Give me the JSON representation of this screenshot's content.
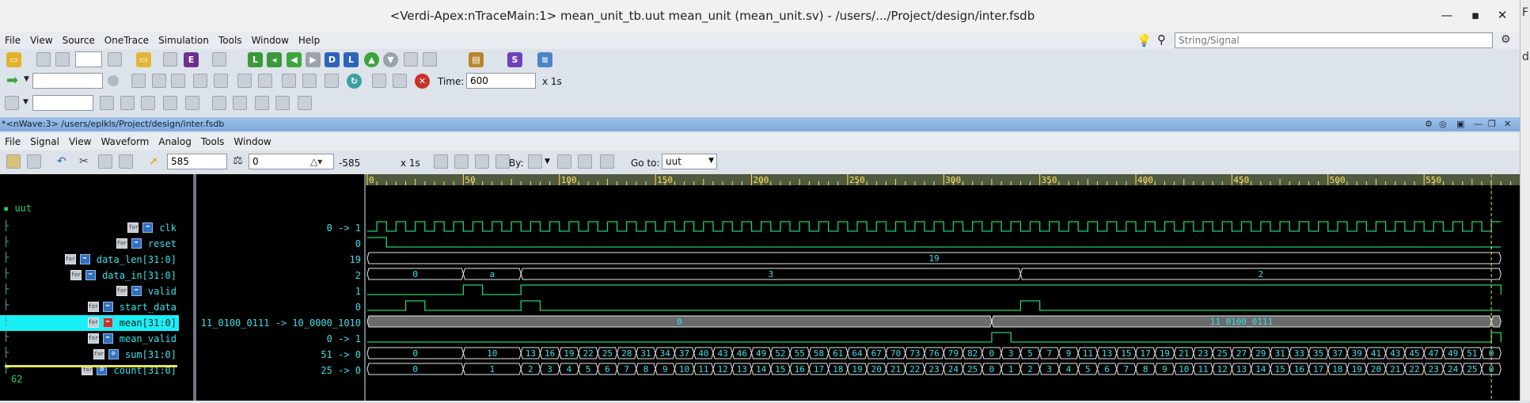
{
  "window": {
    "title": "<Verdi-Apex:nTraceMain:1> mean_unit_tb.uut mean_unit (mean_unit.sv) - /users/.../Project/design/inter.fsdb",
    "min_glyph": "—",
    "max_glyph": "▪",
    "close_glyph": "✕",
    "right_strip_chars": [
      "F",
      "d"
    ]
  },
  "main_menu": [
    "File",
    "View",
    "Source",
    "OneTrace",
    "Simulation",
    "Tools",
    "Window",
    "Help"
  ],
  "search": {
    "placeholder": "String/Signal"
  },
  "main_toolbar2": {
    "time_label": "Time:",
    "time_value": "600",
    "time_unit": "x 1s"
  },
  "nwave": {
    "title": "*<nWave:3> /users/eplkls/Project/design/inter.fsdb",
    "menu": [
      "File",
      "Signal",
      "View",
      "Waveform",
      "Analog",
      "Tools",
      "Window"
    ],
    "cursor_time": "585",
    "marker_time": "0",
    "delta": "-585",
    "unit": "x 1s",
    "by_label": "By:",
    "goto_label": "Go to:",
    "goto_value": "uut"
  },
  "timeline": {
    "ticks": [
      "0",
      "50",
      "100",
      "150",
      "200",
      "250",
      "300",
      "350",
      "400",
      "450",
      "500",
      "550"
    ],
    "tick_values": [
      0,
      50,
      100,
      150,
      200,
      250,
      300,
      350,
      400,
      450,
      500,
      550
    ],
    "max_time": 590,
    "cursor_time": 585
  },
  "scope": {
    "name": "uut"
  },
  "signals": [
    {
      "name": "clk",
      "type": "bit",
      "value": "0 -> 1"
    },
    {
      "name": "reset",
      "type": "bit",
      "value": "0"
    },
    {
      "name": "data_len[31:0]",
      "type": "bus",
      "value": "19"
    },
    {
      "name": "data_in[31:0]",
      "type": "bus",
      "value": "2"
    },
    {
      "name": "valid",
      "type": "bit",
      "value": "1"
    },
    {
      "name": "start_data",
      "type": "bit",
      "value": "0"
    },
    {
      "name": "mean[31:0]",
      "type": "bus",
      "value": "11_0100_0111 -> 10_0000_1010",
      "selected": true
    },
    {
      "name": "mean_valid",
      "type": "bit",
      "value": "0 -> 1"
    },
    {
      "name": "sum[31:0]",
      "type": "bus",
      "value": "51 -> 0"
    },
    {
      "name": "count[31:0]",
      "type": "bus",
      "value": "25 -> 0"
    }
  ],
  "footer_number": "62",
  "waves": {
    "clk_period": 10,
    "reset_high_until": 10,
    "data_len_label": "19",
    "data_in_segments": [
      {
        "t0": 0,
        "t1": 50,
        "label": "0"
      },
      {
        "t0": 50,
        "t1": 80,
        "label": "a"
      },
      {
        "t0": 80,
        "t1": 340,
        "label": "3"
      },
      {
        "t0": 340,
        "t1": 590,
        "label": "2"
      }
    ],
    "valid_pulses": [
      [
        50,
        60
      ],
      [
        80,
        590
      ]
    ],
    "start_data_pulses": [
      [
        20,
        30
      ],
      [
        80,
        90
      ],
      [
        340,
        350
      ]
    ],
    "mean_segments": [
      {
        "t0": 0,
        "t1": 325,
        "label": "0"
      },
      {
        "t0": 325,
        "t1": 585,
        "label": "11_0100_0111"
      },
      {
        "t0": 585,
        "t1": 590,
        "label": "10*"
      }
    ],
    "mean_valid_pulses": [
      [
        325,
        335
      ],
      [
        585,
        590
      ]
    ],
    "sum_values": [
      "0",
      "10",
      "13",
      "16",
      "19",
      "22",
      "25",
      "28",
      "31",
      "34",
      "37",
      "40",
      "43",
      "46",
      "49",
      "52",
      "55",
      "58",
      "61",
      "64",
      "67",
      "70",
      "73",
      "76",
      "79",
      "82",
      "0",
      "3",
      "5",
      "7",
      "9",
      "11",
      "13",
      "15",
      "17",
      "19",
      "21",
      "23",
      "25",
      "27",
      "29",
      "31",
      "33",
      "35",
      "37",
      "39",
      "41",
      "43",
      "45",
      "47",
      "49",
      "51",
      "0"
    ],
    "count_values": [
      "0",
      "1",
      "2",
      "3",
      "4",
      "5",
      "6",
      "7",
      "8",
      "9",
      "10",
      "11",
      "12",
      "13",
      "14",
      "15",
      "16",
      "17",
      "18",
      "19",
      "20",
      "21",
      "22",
      "23",
      "24",
      "25",
      "0",
      "1",
      "2",
      "3",
      "4",
      "5",
      "6",
      "7",
      "8",
      "9",
      "10",
      "11",
      "12",
      "13",
      "14",
      "15",
      "16",
      "17",
      "18",
      "19",
      "20",
      "21",
      "22",
      "23",
      "24",
      "25",
      "0"
    ]
  },
  "colors": {
    "wave": "#1fd46a",
    "bus_border": "#e8e8e8",
    "bus_text": "#39e0e8",
    "selected_row": "#19f0f5",
    "cursor": "#e5e55a",
    "ruler_bg": "#4f5a3e",
    "ruler_text": "#ffe060"
  }
}
